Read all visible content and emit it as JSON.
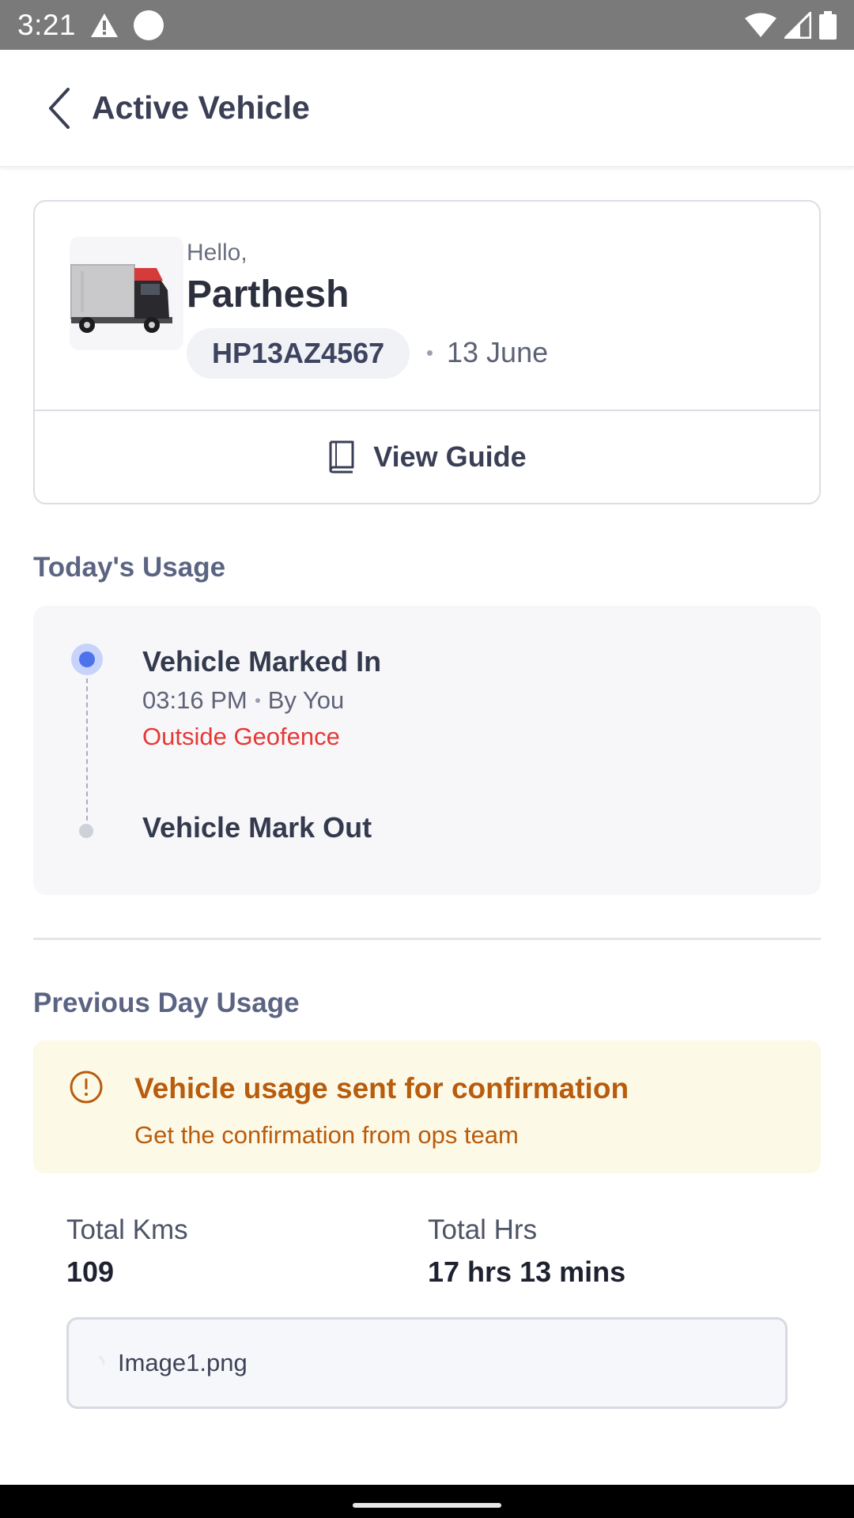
{
  "status_bar": {
    "time": "3:21",
    "icons": [
      "warning-icon",
      "circle-icon",
      "wifi-icon",
      "signal-icon",
      "battery-icon"
    ]
  },
  "app_bar": {
    "title": "Active Vehicle",
    "back_icon": "chevron-left-icon"
  },
  "vehicle_card": {
    "greeting": "Hello,",
    "name": "Parthesh",
    "plate": "HP13AZ4567",
    "date": "13 June",
    "guide_label": "View Guide",
    "guide_icon": "book-icon"
  },
  "todays_usage": {
    "title": "Today's Usage",
    "events": [
      {
        "title": "Vehicle Marked In",
        "time": "03:16 PM",
        "by": "By You",
        "alert": "Outside Geofence"
      },
      {
        "title": "Vehicle Mark Out"
      }
    ]
  },
  "previous_day": {
    "title": "Previous Day Usage",
    "banner_title": "Vehicle usage sent for confirmation",
    "banner_subtitle": "Get the confirmation from ops team",
    "total_kms_label": "Total Kms",
    "total_kms": "109",
    "total_hrs_label": "Total Hrs",
    "total_hrs": "17 hrs 13 mins",
    "attachment": "Image1.png"
  },
  "colors": {
    "accent_blue": "#4c72ec",
    "alert_red": "#e53935",
    "warning_orange": "#b85c0d",
    "warning_bg": "#fdf9e7"
  }
}
